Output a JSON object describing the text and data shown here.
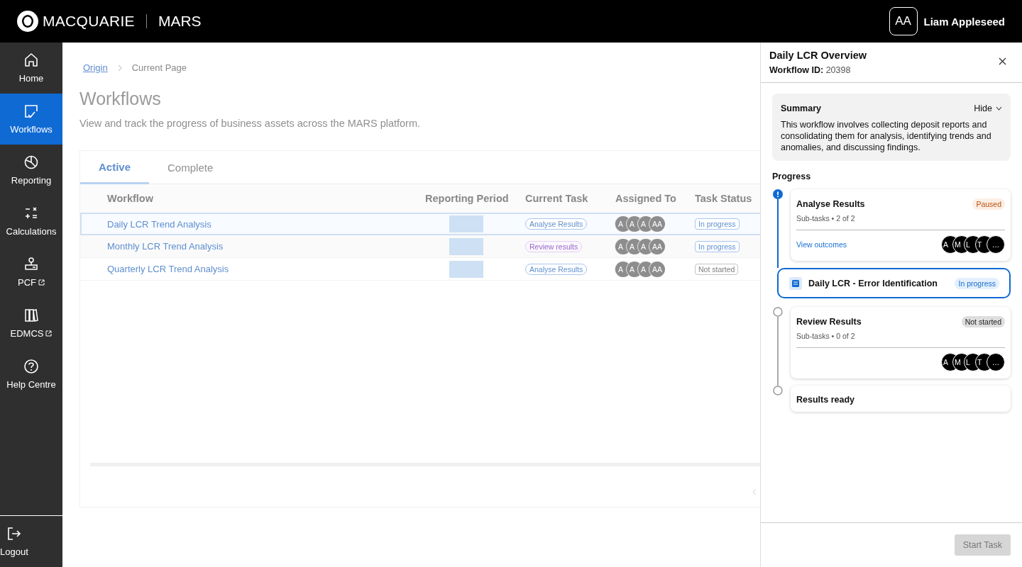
{
  "header": {
    "brand": "MACQUARIE",
    "product": "MARS",
    "user": {
      "initials": "AA",
      "name": "Liam Appleseed"
    }
  },
  "sidebar": {
    "items": [
      {
        "label": "Home",
        "selected": false,
        "external": false
      },
      {
        "label": "Workflows",
        "selected": true,
        "external": false
      },
      {
        "label": "Reporting",
        "selected": false,
        "external": false
      },
      {
        "label": "Calculations",
        "selected": false,
        "external": false
      },
      {
        "label": "PCF",
        "selected": false,
        "external": true
      },
      {
        "label": "EDMCS",
        "selected": false,
        "external": true
      },
      {
        "label": "Help Centre",
        "selected": false,
        "external": false
      }
    ],
    "footer": {
      "label": "Logout"
    }
  },
  "page": {
    "breadcrumb": [
      {
        "label": "Origin",
        "kind": "link"
      },
      {
        "label": "Current Page",
        "kind": "current"
      }
    ],
    "title": "Workflows",
    "subtitle": "View and track the progress of business assets across the MARS platform.",
    "tabs": [
      {
        "label": "Active",
        "selected": true
      },
      {
        "label": "Complete",
        "selected": false
      }
    ],
    "table": {
      "columns": [
        "Workflow",
        "Reporting Period",
        "Current Task",
        "Assigned To",
        "Task Status"
      ],
      "rows": [
        {
          "selected": true,
          "workflow": "Daily LCR Trend Analysis",
          "task": {
            "label": "Analyse Results",
            "kind": "analyse"
          },
          "assignees": [
            "A",
            "A",
            "A",
            "AA"
          ],
          "status": {
            "label": "In progress",
            "kind": "in-progress"
          }
        },
        {
          "selected": false,
          "workflow": "Monthly LCR Trend Analysis",
          "task": {
            "label": "Review results",
            "kind": "review"
          },
          "assignees": [
            "A",
            "A",
            "A",
            "AA"
          ],
          "status": {
            "label": "In progress",
            "kind": "in-progress"
          }
        },
        {
          "selected": false,
          "workflow": "Quarterly LCR Trend Analysis",
          "task": {
            "label": "Analyse Results",
            "kind": "analyse"
          },
          "assignees": [
            "A",
            "A",
            "A",
            "AA"
          ],
          "status": {
            "label": "Not started",
            "kind": "not-started"
          }
        }
      ]
    }
  },
  "panel": {
    "title": "Daily LCR Overview",
    "id_label": "Workflow ID:",
    "id_value": "20398",
    "summary": {
      "title": "Summary",
      "toggle": "Hide",
      "expanded": true,
      "text": "This workflow involves collecting deposit reports and consolidating them for analysis, identifying trends and anomalies, and discussing findings."
    },
    "progress_label": "Progress",
    "steps": [
      {
        "title": "Analyse Results",
        "kind": "attention",
        "badge": {
          "label": "Paused",
          "kind": "paused"
        },
        "subtasks": "Sub-tasks • 2 of 2",
        "link": "View outcomes",
        "assignees": [
          "A",
          "M",
          "L",
          "T",
          "…"
        ],
        "subtask": {
          "label": "Daily LCR - Error Identification",
          "badge": {
            "label": "In progress",
            "kind": "in-progress"
          }
        }
      },
      {
        "title": "Review Results",
        "kind": "pending",
        "badge": {
          "label": "Not started",
          "kind": "not-started"
        },
        "subtasks": "Sub-tasks • 0 of 2",
        "assignees": [
          "A",
          "M",
          "L",
          "T",
          "…"
        ]
      },
      {
        "title": "Results ready",
        "kind": "pending"
      }
    ],
    "button": {
      "label": "Start Task",
      "disabled": true
    }
  }
}
